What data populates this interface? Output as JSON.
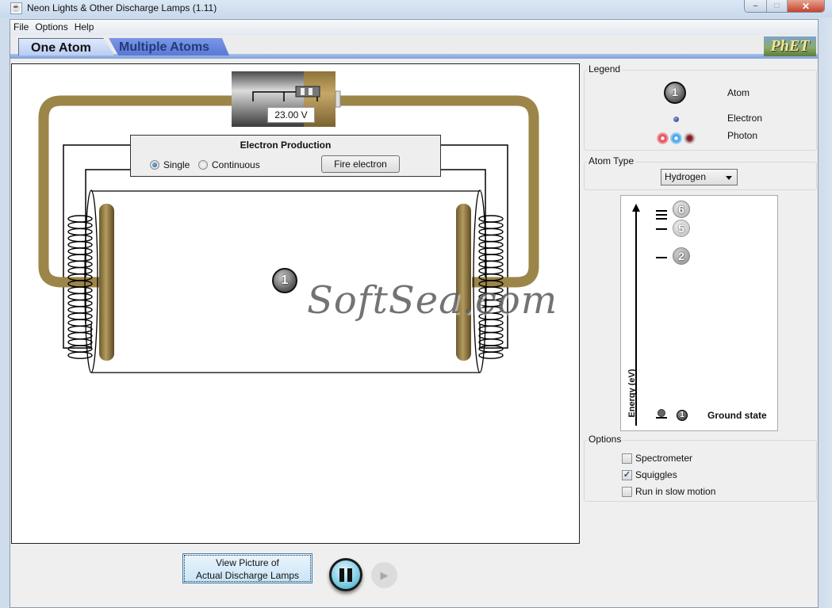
{
  "window": {
    "title": "Neon Lights & Other Discharge Lamps (1.11)",
    "icon": "java-icon",
    "controls": {
      "minimize": "–",
      "maximize": "□",
      "close": "✕"
    }
  },
  "menu": [
    "File",
    "Options",
    "Help"
  ],
  "tabs": [
    {
      "label": "One Atom",
      "active": true
    },
    {
      "label": "Multiple Atoms",
      "active": false
    }
  ],
  "logo": "PhET",
  "simulation": {
    "voltage": "23.00 V",
    "electron_production": {
      "title": "Electron Production",
      "modes": [
        {
          "label": "Single",
          "selected": true
        },
        {
          "label": "Continuous",
          "selected": false
        }
      ],
      "fire_button": "Fire electron"
    },
    "atom_label": "1",
    "watermark": "SoftSea.com"
  },
  "legend": {
    "title": "Legend",
    "items": [
      {
        "icon": "atom-icon",
        "symbol": "1",
        "label": "Atom"
      },
      {
        "icon": "electron-icon",
        "label": "Electron"
      },
      {
        "icon": "photon-icon",
        "label": "Photon"
      }
    ]
  },
  "atom_type": {
    "title": "Atom Type",
    "selected": "Hydrogen"
  },
  "energy_diagram": {
    "axis_label": "Energy (eV)",
    "levels": [
      "6",
      "5",
      "2",
      "1"
    ],
    "ground_label": "Ground state"
  },
  "options": {
    "title": "Options",
    "items": [
      {
        "label": "Spectrometer",
        "checked": false
      },
      {
        "label": "Squiggles",
        "checked": true
      },
      {
        "label": "Run in slow motion",
        "checked": false
      }
    ]
  },
  "bottom": {
    "view_button_line1": "View Picture of",
    "view_button_line2": "Actual Discharge Lamps",
    "step_symbol": "▶"
  }
}
